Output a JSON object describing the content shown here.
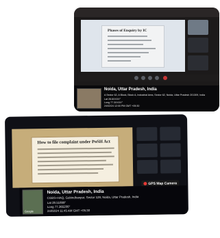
{
  "photo1": {
    "slide_title": "Phases of Enquiry by IC",
    "gps": {
      "title": "Noida, Uttar Pradesh, India",
      "address": "A Sector 62, A Block, Block A, Industrial Area, Sector 62, Noida, Uttar Pradesh 201309, India",
      "lat": "Lat 28.6XXXX°",
      "long": "Long 77.3XXXX°",
      "datetime": "24/02/24 12:00 PM GMT +05:30"
    }
  },
  "photo2": {
    "slide_title": "How to file complaint under PoSH Act",
    "badge": "GPS Map Camera",
    "gps": {
      "title": "Noida, Uttar Pradesh, India",
      "address": "CGBS+HAQ, Gobindhanpur, Sector 128, Noida, Uttar Pradesh, India",
      "lat": "Lat 28.51899°",
      "long": "Long 77.365206°",
      "datetime": "24/02/24 11:45 AM GMT +05:30"
    },
    "thumb_label": "Google"
  }
}
